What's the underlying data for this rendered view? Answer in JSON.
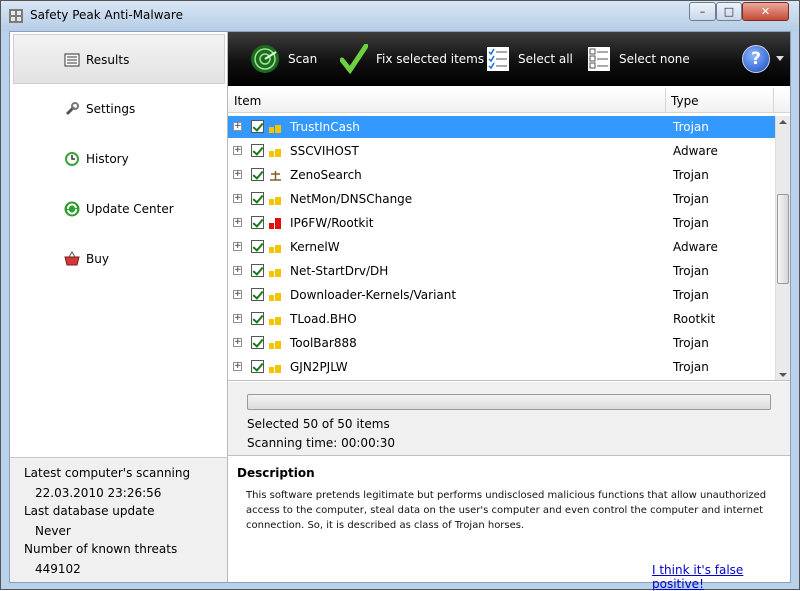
{
  "window": {
    "title": "Safety Peak Anti-Malware",
    "min": "–",
    "max": "□",
    "close": "✕"
  },
  "sidebar": {
    "items": [
      {
        "label": "Results",
        "icon": "results-list-icon"
      },
      {
        "label": "Settings",
        "icon": "wrench-icon"
      },
      {
        "label": "History",
        "icon": "clock-icon"
      },
      {
        "label": "Update Center",
        "icon": "update-refresh-icon"
      },
      {
        "label": "Buy",
        "icon": "shopping-basket-icon"
      }
    ],
    "info": {
      "last_scan_label": "Latest computer's scanning",
      "last_scan_value": "22.03.2010 23:26:56",
      "db_update_label": "Last database update",
      "db_update_value": "Never",
      "threats_label": "Number of known threats",
      "threats_value": "449102"
    }
  },
  "toolbar": {
    "scan": "Scan",
    "fix": "Fix selected items",
    "select_all": "Select all",
    "select_none": "Select none",
    "help": "?"
  },
  "list": {
    "columns": {
      "item": "Item",
      "type": "Type"
    },
    "rows": [
      {
        "name": "TrustInCash",
        "type": "Trojan",
        "severity": "low",
        "selected": true
      },
      {
        "name": "SSCVIHOST",
        "type": "Adware",
        "severity": "low",
        "selected": false
      },
      {
        "name": "ZenoSearch",
        "type": "Trojan",
        "severity": "scale",
        "selected": false
      },
      {
        "name": "NetMon/DNSChange",
        "type": "Trojan",
        "severity": "low",
        "selected": false
      },
      {
        "name": "IP6FW/Rootkit",
        "type": "Trojan",
        "severity": "high",
        "selected": false
      },
      {
        "name": "KernelW",
        "type": "Adware",
        "severity": "low",
        "selected": false
      },
      {
        "name": "Net-StartDrv/DH",
        "type": "Trojan",
        "severity": "low",
        "selected": false
      },
      {
        "name": "Downloader-Kernels/Variant",
        "type": "Trojan",
        "severity": "low",
        "selected": false
      },
      {
        "name": "TLoad.BHO",
        "type": "Rootkit",
        "severity": "low",
        "selected": false
      },
      {
        "name": "ToolBar888",
        "type": "Trojan",
        "severity": "low",
        "selected": false
      },
      {
        "name": "GJN2PJLW",
        "type": "Trojan",
        "severity": "low",
        "selected": false
      }
    ]
  },
  "status": {
    "selected_text": "Selected 50 of 50 items",
    "scan_time": "Scanning time: 00:00:30",
    "progress": 0
  },
  "description": {
    "title": "Description",
    "text": "This software pretends legitimate but performs undisclosed malicious functions that allow unauthorized access to the computer, steal data on the user's computer and even control the computer and internet connection. So, it is described as class of Trojan horses.",
    "false_positive_link": "I think it's false positive!"
  },
  "colors": {
    "selection": "#3399ff",
    "severity_low": "#f5c400",
    "severity_high": "#e01010",
    "toolbar": "#111111"
  }
}
